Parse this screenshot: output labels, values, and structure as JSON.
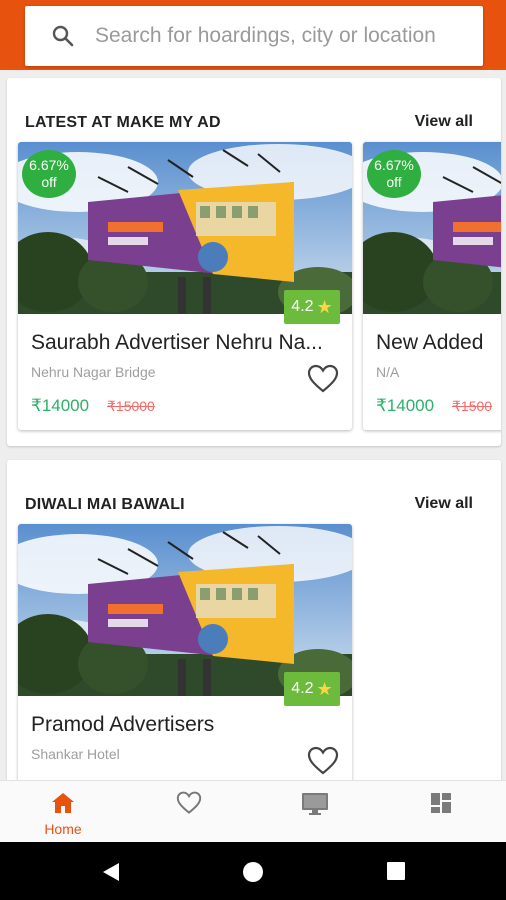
{
  "search": {
    "placeholder": "Search for hoardings, city or location",
    "icon": "search-icon"
  },
  "sections": [
    {
      "title": "LATEST AT MAKE MY AD",
      "view_all": "View all",
      "cards": [
        {
          "discount_line1": "6.67%",
          "discount_line2": "off",
          "rating": "4.2",
          "name": "Saurabh Advertiser Nehru Na...",
          "location": "Nehru Nagar Bridge",
          "price": "₹14000",
          "old_price": "₹15000"
        },
        {
          "discount_line1": "6.67%",
          "discount_line2": "off",
          "rating": "",
          "name": "New Added",
          "location": "N/A",
          "price": "₹14000",
          "old_price": "₹1500"
        }
      ]
    },
    {
      "title": "DIWALI MAI BAWALI",
      "view_all": "View all",
      "cards": [
        {
          "rating": "4.2",
          "name": "Pramod Advertisers",
          "location": "Shankar Hotel"
        }
      ]
    }
  ],
  "bottom_nav": [
    {
      "label": "Home",
      "icon": "home-icon",
      "active": true
    },
    {
      "label": "",
      "icon": "heart-icon",
      "active": false
    },
    {
      "label": "",
      "icon": "monitor-icon",
      "active": false
    },
    {
      "label": "",
      "icon": "dashboard-icon",
      "active": false
    }
  ],
  "colors": {
    "accent": "#e8520f",
    "discount": "#2eaf3f",
    "rating": "#6dbb3d",
    "price": "#2eaf6a",
    "old_price": "#f26a6a"
  }
}
